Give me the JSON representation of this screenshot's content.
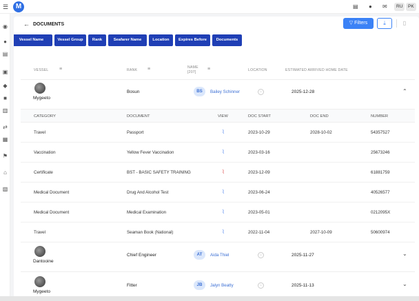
{
  "app": {
    "logo": "M",
    "languages": [
      "RU",
      "PK"
    ]
  },
  "header": {
    "title": "DOCUMENTS",
    "filters_label": "Filters"
  },
  "filter_chips": [
    "Vessel Name",
    "Vessel Group",
    "Rank",
    "Seafarer Name",
    "Location",
    "Expires Before",
    "Documents"
  ],
  "table": {
    "columns": {
      "vessel": "VESSEL",
      "rank": "RANK",
      "name": "NAME",
      "name_count": "[207]",
      "location": "LOCATION",
      "eta": "ESTIMATED ARRIVED HOME DATE"
    },
    "rows": [
      {
        "vessel": "Mygeeto",
        "rank": "Bosun",
        "initials": "BS",
        "name": "Bailey Schinner",
        "eta": "2025-12-28",
        "expanded": true
      },
      {
        "vessel": "Dantooine",
        "rank": "Chief Engineer",
        "initials": "AT",
        "name": "Aida Thiel",
        "eta": "2025-11-27",
        "expanded": false
      },
      {
        "vessel": "Mygeeto",
        "rank": "Fitter",
        "initials": "JB",
        "name": "Jalyn Beatty",
        "eta": "2025-11-13",
        "expanded": false
      }
    ]
  },
  "documents": {
    "columns": {
      "category": "CATEGORY",
      "document": "DOCUMENT",
      "view": "VIEW",
      "start": "DOC START",
      "end": "DOC END",
      "number": "NUMBER"
    },
    "rows": [
      {
        "category": "Travel",
        "document": "Passport",
        "start": "2023-10-29",
        "end": "2028-10-02",
        "number": "54357527",
        "icon_color": "blue"
      },
      {
        "category": "Vaccination",
        "document": "Yellow Fever Vaccination",
        "start": "2023-03-16",
        "end": "",
        "number": "25673246",
        "icon_color": "blue"
      },
      {
        "category": "Certificate",
        "document": "BST - BASIC SAFETY TRAINING",
        "start": "2023-12-09",
        "end": "",
        "number": "61881759",
        "icon_color": "red"
      },
      {
        "category": "Medical Document",
        "document": "Drug And Alcohol Test",
        "start": "2023-06-24",
        "end": "",
        "number": "40526577",
        "icon_color": "blue"
      },
      {
        "category": "Medical Document",
        "document": "Medical Examination",
        "start": "2023-05-01",
        "end": "",
        "number": "0212095X",
        "icon_color": "blue"
      },
      {
        "category": "Travel",
        "document": "Seaman Book (National)",
        "start": "2022-11-04",
        "end": "2027-10-09",
        "number": "50600974",
        "icon_color": "blue"
      }
    ]
  },
  "colors": {
    "accent": "#3b82f6",
    "chip": "#1f3fb5"
  }
}
